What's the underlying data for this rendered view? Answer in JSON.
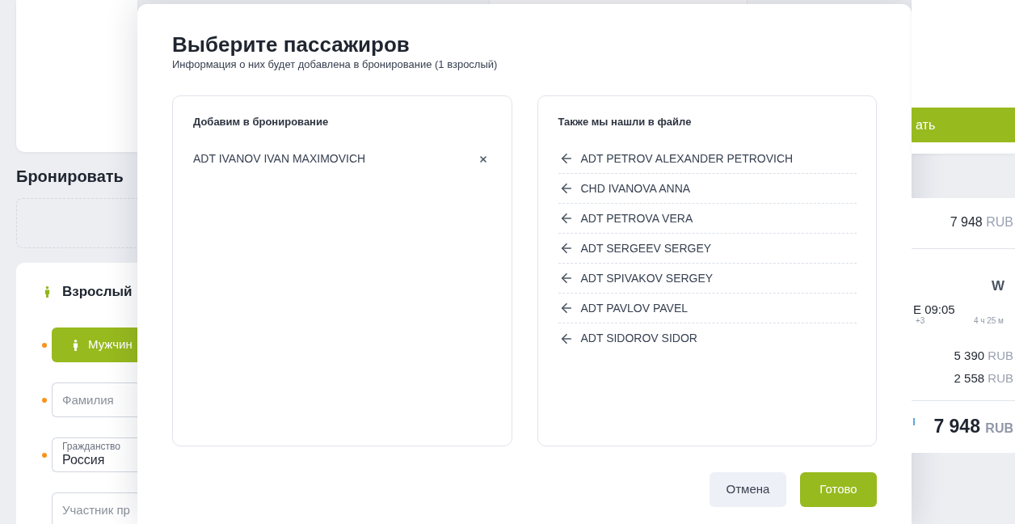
{
  "booking_form": {
    "title": "Бронировать",
    "passenger": {
      "type_label": "Взрослый",
      "gender_option": {
        "label": "Мужчин",
        "selected": true,
        "required": true
      },
      "fields": [
        {
          "kind": "input",
          "placeholder": "Фамилия",
          "required": true
        },
        {
          "kind": "select",
          "label": "Гражданство",
          "value": "Россия",
          "required": true
        },
        {
          "kind": "input",
          "placeholder": "Участник пр",
          "required": false
        }
      ]
    }
  },
  "dialog": {
    "title": "Выберите пассажиров",
    "subtitle": "Информация о них будет добавлена в бронирование (1 взрослый)",
    "added": {
      "heading": "Добавим в бронирование",
      "passengers": [
        "ADT IVANOV IVAN MAXIMOVICH"
      ]
    },
    "found": {
      "heading": "Также мы нашли в файле",
      "passengers": [
        "ADT PETROV ALEXANDER PETROVICH",
        "CHD IVANOVA ANNA",
        "ADT PETROVA VERA",
        "ADT SERGEEV SERGEY",
        "ADT SPIVAKOV SERGEY",
        "ADT PAVLOV PAVEL",
        "ADT SIDOROV SIDOR"
      ]
    },
    "buttons": [
      {
        "label": "Отмена",
        "kind": "secondary"
      },
      {
        "label": "Готово",
        "kind": "primary"
      }
    ]
  },
  "price_summary": {
    "action_button": "ать",
    "fare": {
      "amount": "7 948",
      "currency": "RUB"
    },
    "flight": {
      "fare_class": "W",
      "time": "E 09:05",
      "day_offset": "+3",
      "duration": "4 ч 25 м"
    },
    "lines": [
      {
        "amount": "5 390",
        "currency": "RUB"
      },
      {
        "amount": "2 558",
        "currency": "RUB"
      }
    ],
    "total": {
      "amount": "7 948",
      "currency": "RUB"
    }
  }
}
